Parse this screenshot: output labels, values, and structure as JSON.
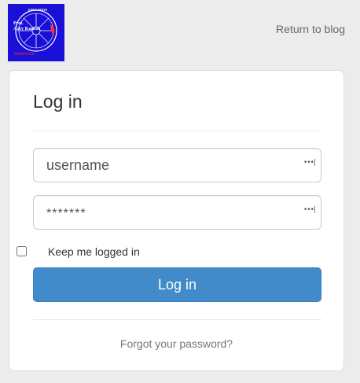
{
  "logo": {
    "line1": "Prof.",
    "line2": "Ajey Kamat",
    "line3": "EDUCATION",
    "line4": "MEDIATOR",
    "colors": {
      "background": "#1a0fd6",
      "text": "#ffffff",
      "accent": "#ff3030"
    }
  },
  "header": {
    "return_label": "Return to blog"
  },
  "card": {
    "title": "Log in",
    "username": {
      "placeholder": "username",
      "value": "",
      "icon": "password-dots-icon"
    },
    "password": {
      "placeholder": "*******",
      "value": "",
      "icon": "password-dots-icon"
    },
    "remember_label": "Keep me logged in",
    "remember_checked": false,
    "login_label": "Log in",
    "forgot_label": "Forgot your password?"
  },
  "colors": {
    "page_bg": "#ececec",
    "primary": "#428bca",
    "link": "#666666"
  }
}
